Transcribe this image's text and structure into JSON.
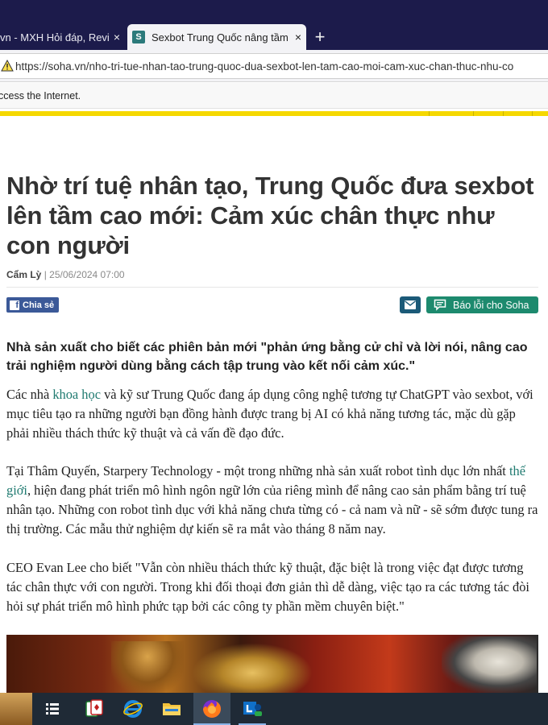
{
  "browser": {
    "tabs": [
      {
        "title": "vn - MXH Hỏi đáp, Revie",
        "active": false
      },
      {
        "title": "Sexbot Trung Quốc nâng tầm c",
        "active": true,
        "favicon": "S"
      }
    ],
    "close_icon": "×",
    "new_tab_icon": "+",
    "url": "https://soha.vn/nho-tri-tue-nhan-tao-trung-quoc-dua-sexbot-len-tam-cao-moi-cam-xuc-chan-thuc-nhu-co",
    "notification": "ccess the Internet."
  },
  "article": {
    "title": "Nhờ trí tuệ nhân tạo, Trung Quốc đưa sexbot lên tầm cao mới: Cảm xúc chân thực như con người",
    "author": "Cẩm Lỳ",
    "separator": " | ",
    "date": "25/06/2024 07:00",
    "share_label": "Chia sẻ",
    "report_label": "Báo lỗi cho Soha",
    "sapo": "Nhà sản xuất cho biết các phiên bản mới \"phản ứng bằng cử chỉ và lời nói, nâng cao trải nghiệm người dùng bằng cách tập trung vào kết nối cảm xúc.\"",
    "p1": {
      "a": "Các nhà ",
      "link": "khoa học",
      "b": " và kỹ sư Trung Quốc đang áp dụng công nghệ tương tự ChatGPT vào sexbot, với mục tiêu tạo ra những người bạn đồng hành được trang bị AI có khả năng tương tác, mặc dù gặp phải nhiều thách thức kỹ thuật và cả vấn đề đạo đức."
    },
    "p2": {
      "a": "Tại Thâm Quyến, Starpery Technology - một trong những nhà sản xuất robot tình dục lớn nhất ",
      "link": "thế giới",
      "b": ", hiện đang phát triển mô hình ngôn ngữ lớn của riêng mình để nâng cao sản phẩm bằng trí tuệ nhân tạo. Những con robot tình dục với khả năng chưa từng có - cả nam và nữ - sẽ sớm được tung ra thị trường. Các mẫu thử nghiệm dự kiến sẽ ra mắt vào tháng 8 năm nay."
    },
    "p3": "CEO Evan Lee cho biết \"Vẫn còn nhiều thách thức kỹ thuật, đặc biệt là trong việc đạt được tương tác chân thực với con người. Trong khi đối thoại đơn giản thì dễ dàng, việc tạo ra các tương tác đòi hỏi sự phát triển mô hình phức tạp bởi các công ty phần mềm chuyên biệt.\""
  },
  "taskbar": {
    "items": [
      "task-view-icon",
      "solitaire-icon",
      "internet-explorer-icon",
      "file-explorer-icon",
      "firefox-icon",
      "lync-icon"
    ]
  },
  "colors": {
    "tabbar_bg": "#1c1b4b",
    "link": "#1f7a70",
    "facebook": "#3b5998",
    "report_button": "#1d8a6e",
    "accent_yellow": "#f5d800"
  }
}
